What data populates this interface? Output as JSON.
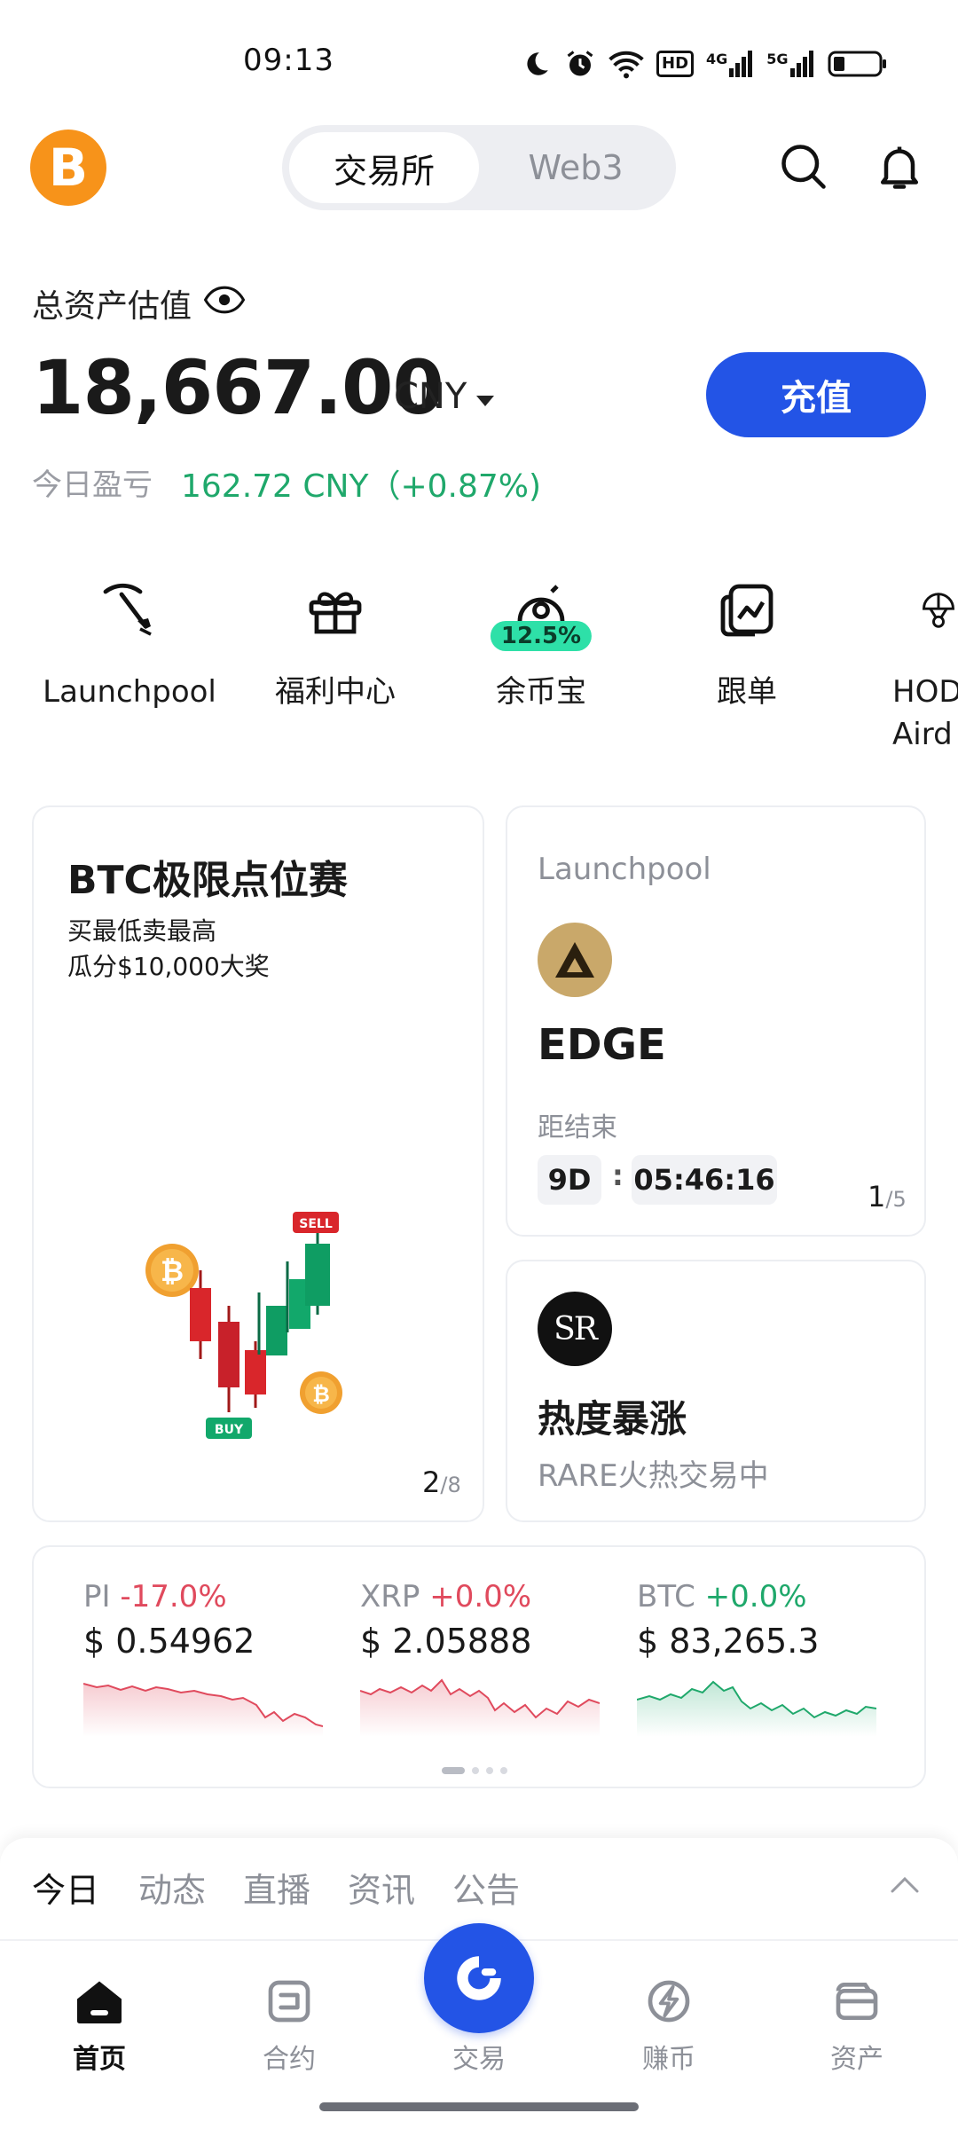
{
  "status": {
    "time": "09:13",
    "icons": [
      "moon-icon",
      "alarm-icon",
      "wifi-icon",
      "hd-icon",
      "signal-4g-icon",
      "signal-5g-icon",
      "battery-icon"
    ],
    "hd_text": "HD",
    "net1": "4G",
    "net2": "5G"
  },
  "header": {
    "tabs": [
      {
        "label": "交易所",
        "active": true
      },
      {
        "label": "Web3",
        "active": false
      }
    ],
    "logo_symbol": "B"
  },
  "assets": {
    "label": "总资产估值",
    "value": "18,667.00",
    "currency": "CNY",
    "deposit_label": "充值",
    "pnl_label": "今日盈亏",
    "pnl_value": "162.72 CNY（+0.87%)"
  },
  "shortcuts": [
    {
      "label": "Launchpool",
      "icon": "pickaxe-icon"
    },
    {
      "label": "福利中心",
      "icon": "gift-icon"
    },
    {
      "label": "余币宝",
      "icon": "savings-icon",
      "badge": "12.5%"
    },
    {
      "label": "跟单",
      "icon": "copy-trade-icon"
    },
    {
      "label": "HOD\nAird",
      "icon": "airdrop-icon"
    }
  ],
  "promo": {
    "title": "BTC极限点位赛",
    "subtitle_line1": "买最低卖最高",
    "subtitle_line2": "瓜分$10,000大奖",
    "sell_tag": "SELL",
    "buy_tag": "BUY",
    "page": "2",
    "page_total": "/8"
  },
  "launchpool_card": {
    "label": "Launchpool",
    "token": "EDGE",
    "ends_label": "距结束",
    "days": "9D",
    "separator": ":",
    "time": "05:46:16",
    "page": "1",
    "page_total": "/5"
  },
  "hot_card": {
    "logo_text": "SR",
    "title": "热度暴涨",
    "subtitle": "RARE火热交易中"
  },
  "tickers": [
    {
      "symbol": "PI",
      "change": "-17.0%",
      "price": "$ 0.54962",
      "trend": "down"
    },
    {
      "symbol": "XRP",
      "change": "+0.0%",
      "price": "$ 2.05888",
      "trend": "down"
    },
    {
      "symbol": "BTC",
      "change": "+0.0%",
      "price": "$ 83,265.3",
      "trend": "up"
    }
  ],
  "colors": {
    "accent": "#2354e6",
    "up": "#1fa86b",
    "down": "#e04a5d",
    "btc_orange": "#f7931a"
  },
  "feed_tabs": [
    {
      "label": "今日",
      "active": true
    },
    {
      "label": "动态",
      "active": false
    },
    {
      "label": "直播",
      "active": false
    },
    {
      "label": "资讯",
      "active": false
    },
    {
      "label": "公告",
      "active": false
    }
  ],
  "bottom_nav": [
    {
      "label": "首页",
      "icon": "home-icon",
      "active": true
    },
    {
      "label": "合约",
      "icon": "contract-icon",
      "active": false
    },
    {
      "label": "交易",
      "icon": "trade-icon",
      "active": false
    },
    {
      "label": "赚币",
      "icon": "earn-icon",
      "active": false
    },
    {
      "label": "资产",
      "icon": "wallet-icon",
      "active": false
    }
  ]
}
